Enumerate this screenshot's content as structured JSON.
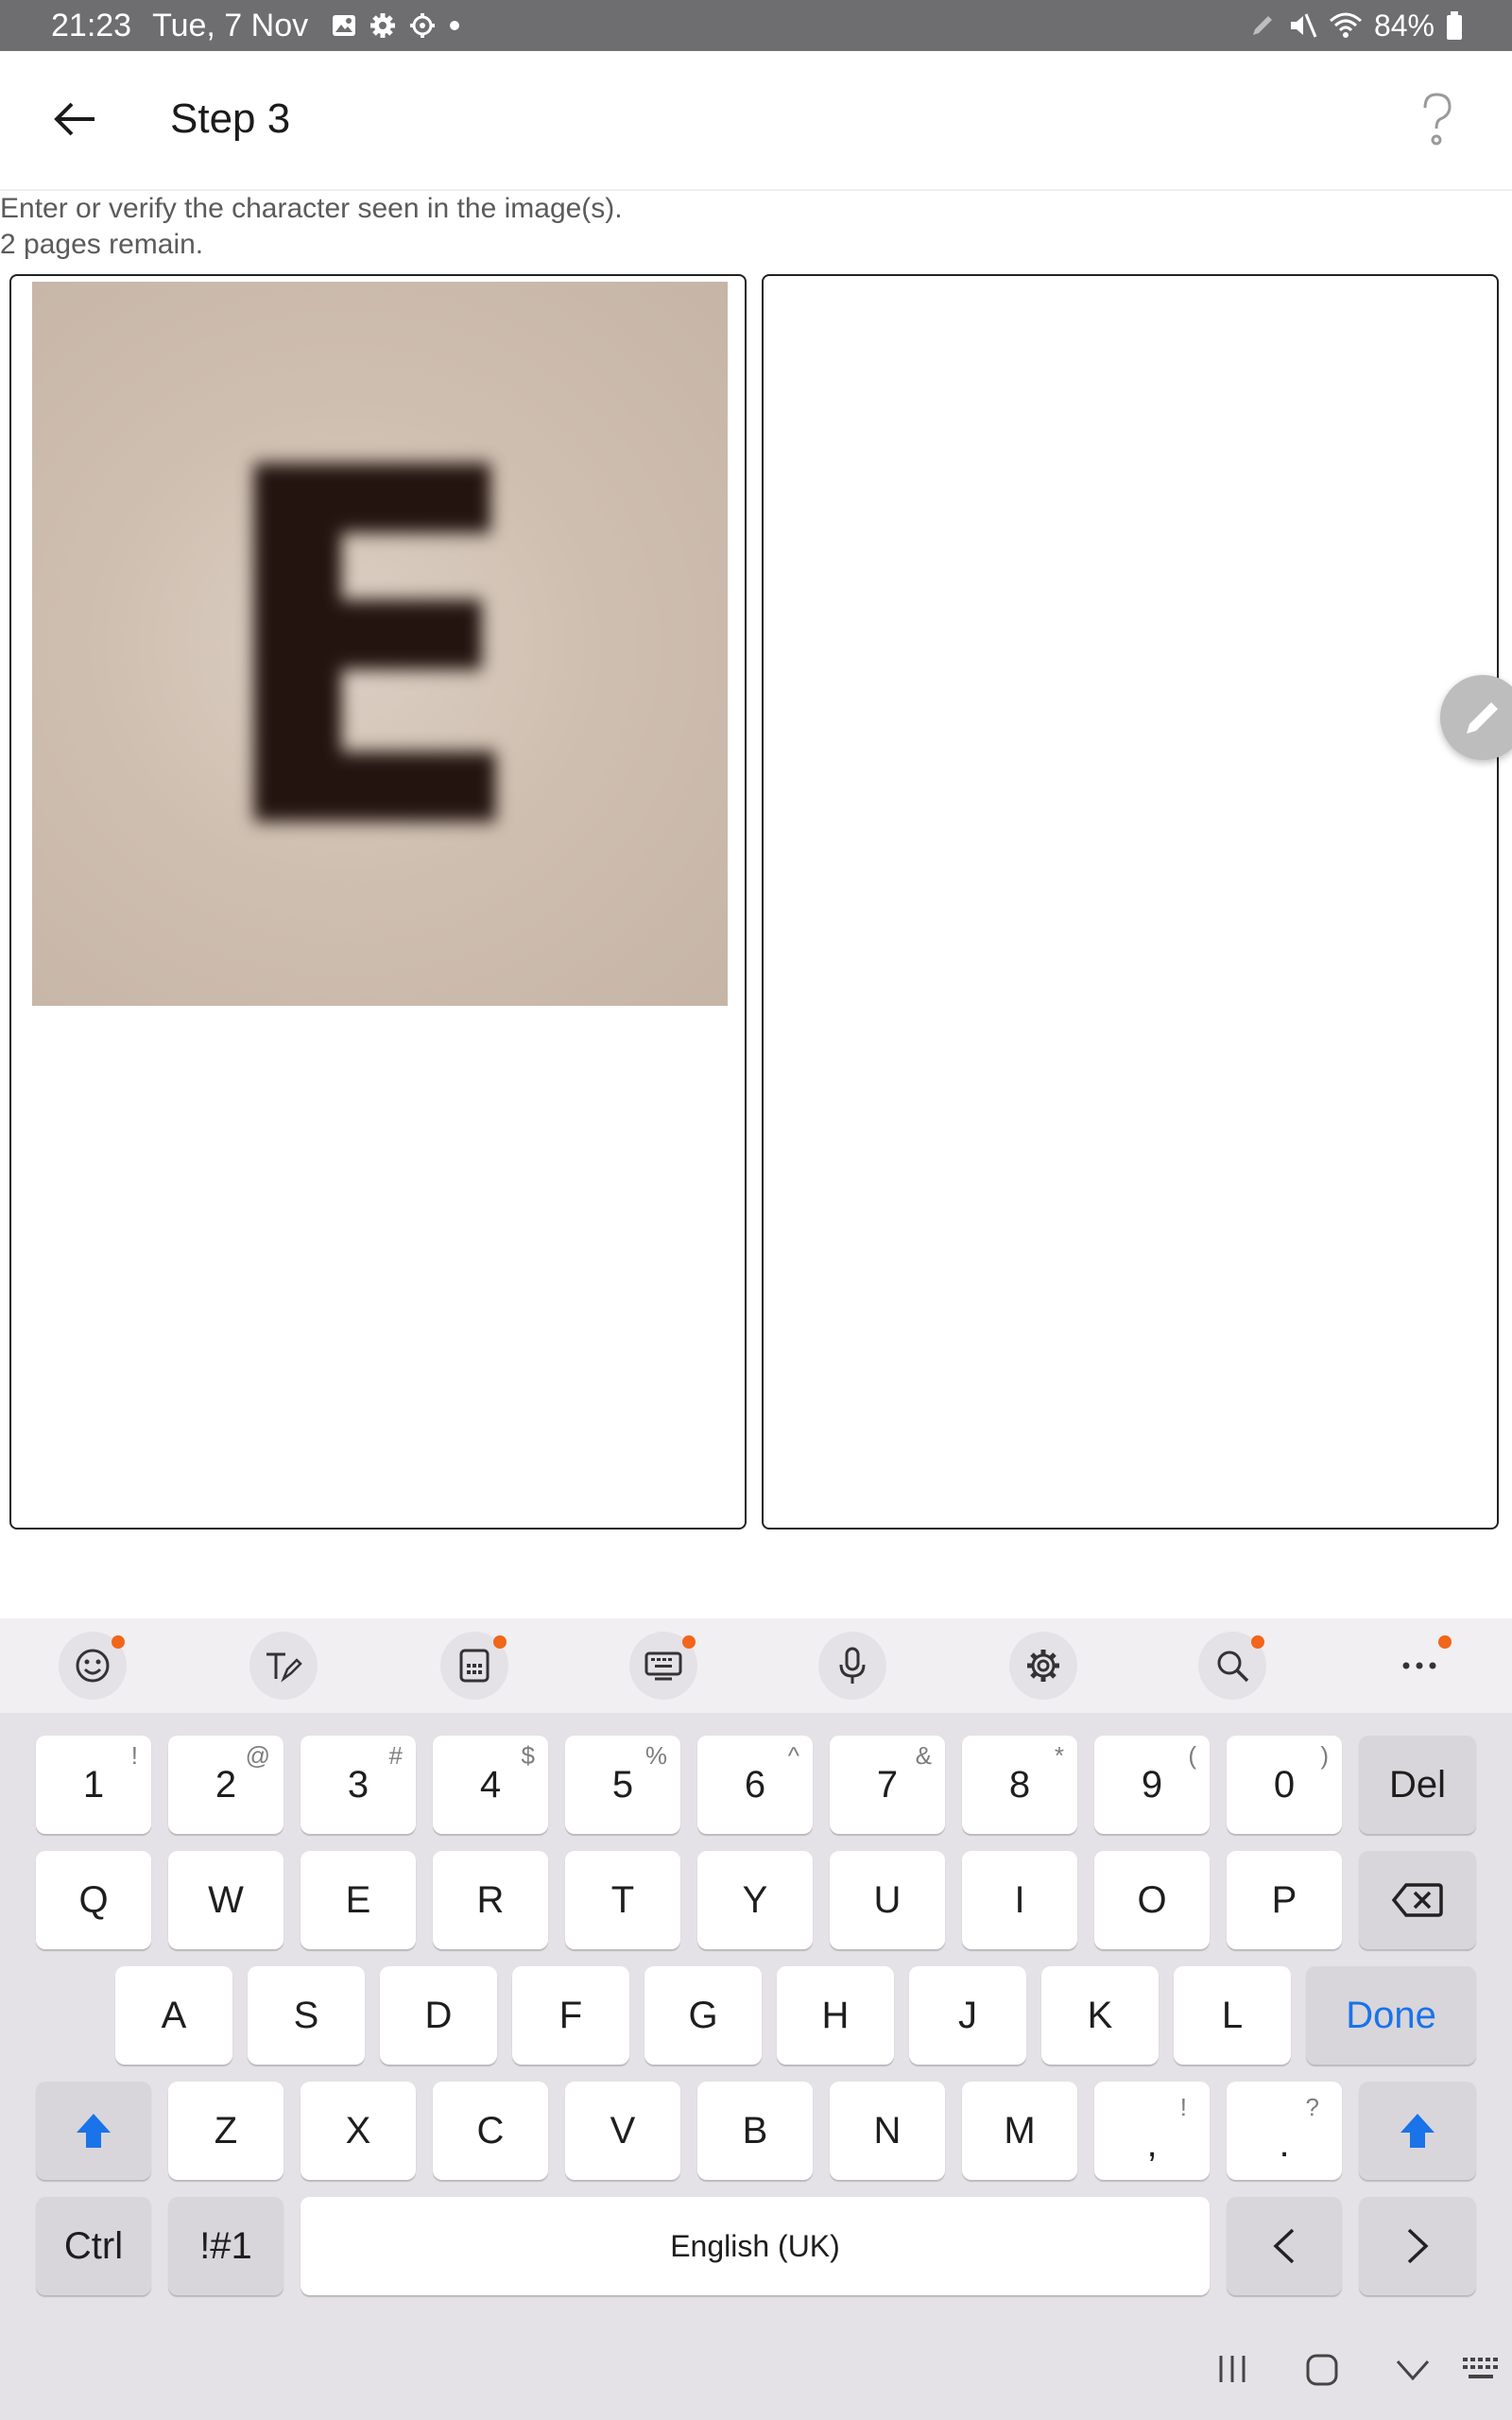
{
  "status_bar": {
    "time": "21:23",
    "date": "Tue, 7 Nov",
    "battery": "84%"
  },
  "app_bar": {
    "title": "Step 3"
  },
  "instructions": {
    "line1": "Enter or verify the character seen in the image(s).",
    "line2": "2 pages remain."
  },
  "image_panel": {
    "character": "E"
  },
  "keyboard": {
    "row1": [
      {
        "label": "1",
        "sup": "!"
      },
      {
        "label": "2",
        "sup": "@"
      },
      {
        "label": "3",
        "sup": "#"
      },
      {
        "label": "4",
        "sup": "$"
      },
      {
        "label": "5",
        "sup": "%"
      },
      {
        "label": "6",
        "sup": "^"
      },
      {
        "label": "7",
        "sup": "&"
      },
      {
        "label": "8",
        "sup": "*"
      },
      {
        "label": "9",
        "sup": "("
      },
      {
        "label": "0",
        "sup": ")"
      }
    ],
    "del_label": "Del",
    "row2": [
      "Q",
      "W",
      "E",
      "R",
      "T",
      "Y",
      "U",
      "I",
      "O",
      "P"
    ],
    "row3": [
      "A",
      "S",
      "D",
      "F",
      "G",
      "H",
      "J",
      "K",
      "L"
    ],
    "done_label": "Done",
    "row4": [
      "Z",
      "X",
      "C",
      "V",
      "B",
      "N",
      "M"
    ],
    "comma": {
      "label": ",",
      "sup": "!"
    },
    "period": {
      "label": ".",
      "sup": "?"
    },
    "ctrl_label": "Ctrl",
    "symbols_label": "!#1",
    "space_label": "English (UK)"
  }
}
